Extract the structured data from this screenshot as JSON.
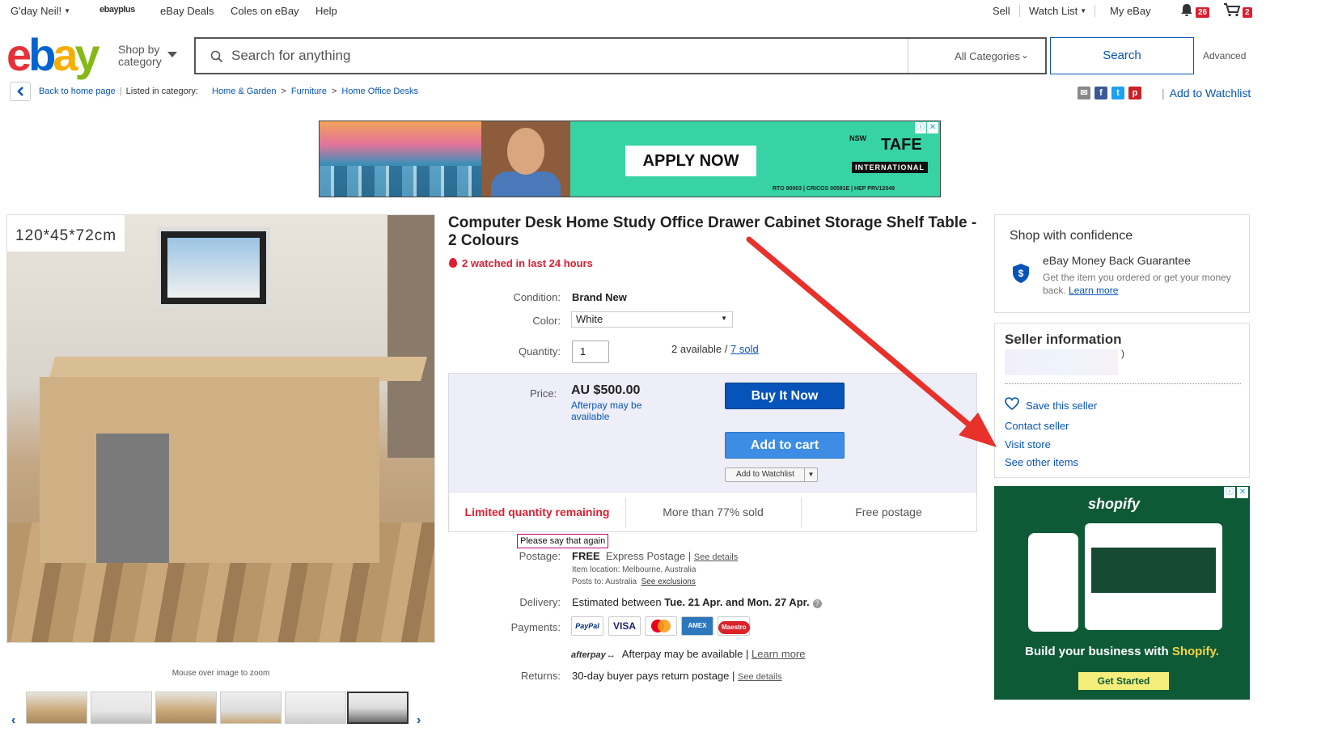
{
  "topbar": {
    "greeting": "G'day Neil!",
    "ebayplus": "ebayplus",
    "deals": "eBay Deals",
    "coles": "Coles on eBay",
    "help": "Help",
    "sell": "Sell",
    "watchlist": "Watch List",
    "myebay": "My eBay",
    "notifications_count": "26",
    "cart_count": "2"
  },
  "header": {
    "logo": {
      "e": "e",
      "b": "b",
      "a": "a",
      "y": "y"
    },
    "shop_by": "Shop by",
    "category": "category",
    "search_placeholder": "Search for anything",
    "category_select": "All Categories",
    "search_button": "Search",
    "advanced": "Advanced"
  },
  "breadcrumb": {
    "back": "Back to home page",
    "listed_in": "Listed in category:",
    "items": [
      "Home & Garden",
      "Furniture",
      "Home Office Desks"
    ],
    "add_to_watchlist": "Add to Watchlist"
  },
  "banner": {
    "cta": "APPLY NOW",
    "brand_nsw": "NSW",
    "brand": "TAFE",
    "brand_sub": "INTERNATIONAL",
    "rto": "RTO 90003 | CRICOS 00591E | HEP PRV12049"
  },
  "product": {
    "image_label": "120*45*72cm",
    "zoom_hint": "Mouse over image to zoom",
    "title": "Computer Desk Home Study Office Drawer Cabinet Storage Shelf Table - 2 Colours",
    "watched": "2 watched in last 24 hours",
    "condition_label": "Condition:",
    "condition": "Brand New",
    "color_label": "Color:",
    "color": "White",
    "quantity_label": "Quantity:",
    "quantity": "1",
    "available": "2 available /",
    "sold": "7 sold",
    "price_label": "Price:",
    "price": "AU $500.00",
    "afterpay_note": "Afterpay may be available",
    "buy_now": "Buy It Now",
    "add_to_cart": "Add to cart",
    "add_to_watchlist": "Add to Watchlist",
    "limited": "Limited quantity remaining",
    "sold_pct": "More than 77% sold",
    "free_postage": "Free postage",
    "tooltip": "Please say that again",
    "postage_label": "Postage:",
    "postage_free": "FREE",
    "postage_type": "Express Postage |",
    "see_details": "See details",
    "item_location": "Item location:  Melbourne, Australia",
    "posts_to": "Posts to:  Australia",
    "see_exclusions": "See exclusions",
    "delivery_label": "Delivery:",
    "delivery_pre": "Estimated between",
    "delivery_dates": "Tue. 21 Apr. and Mon. 27 Apr.",
    "payments_label": "Payments:",
    "payment_methods": [
      "PayPal",
      "VISA",
      "MC",
      "AMEX",
      "Maestro"
    ],
    "afterpay_logo": "afterpay",
    "afterpay_text": "Afterpay may be available |",
    "learn_more": "Learn more",
    "returns_label": "Returns:",
    "returns": "30-day buyer pays return postage |",
    "returns_details": "See details"
  },
  "confidence": {
    "title": "Shop with confidence",
    "mbg_title": "eBay Money Back Guarantee",
    "mbg_text": "Get the item you ordered or get your money back.",
    "learn_more": "Learn more"
  },
  "seller": {
    "title": "Seller information",
    "paren": ")",
    "save": "Save this seller",
    "contact": "Contact seller",
    "visit": "Visit store",
    "other": "See other items"
  },
  "shopify_ad": {
    "logo": "shopify",
    "tagline_pre": "Build your business with",
    "tagline_brand": "Shopify.",
    "cta": "Get Started"
  },
  "colors": {
    "ebay_blue": "#0654ba",
    "alert_red": "#dd1e31",
    "arrow_red": "#e8312a",
    "shopify_green": "#0e5a37"
  }
}
